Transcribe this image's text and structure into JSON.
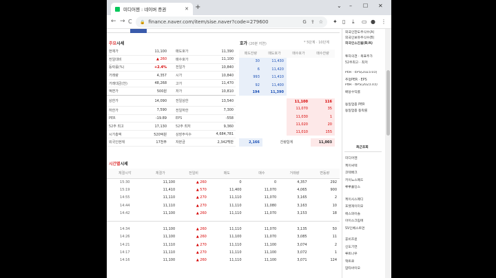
{
  "browser": {
    "tab_title": "미디어젠 : 네이버 증권",
    "url": "finance.naver.com/item/sise.naver?code=279600",
    "new_tab": "+",
    "back": "←",
    "forward": "→",
    "reload": "C",
    "controls": [
      "⌄",
      "–",
      "☐",
      "✕"
    ]
  },
  "quote": {
    "title_red": "주요",
    "title_rest": "시세",
    "rows": [
      [
        "현재가",
        "11,100",
        "매도호가",
        "11,390"
      ],
      [
        "전일대비",
        "▲ 260",
        "매수호가",
        "11,100"
      ],
      [
        "등락률(%)",
        "+2.4%",
        "전일가",
        "10,840"
      ],
      [
        "거래량",
        "4,357",
        "시가",
        "10,840"
      ],
      [
        "거래대금(천)",
        "48,268",
        "고가",
        "11,470"
      ],
      [
        "액면가",
        "500원",
        "저가",
        "10,810"
      ],
      [
        "상한가",
        "14,090",
        "전일상한",
        "13,540"
      ],
      [
        "하한가",
        "7,590",
        "전일하한",
        "7,300"
      ],
      [
        "PER",
        "-19.89",
        "EPS",
        "-558"
      ],
      [
        "52주 최고",
        "17,130",
        "52주 최저",
        "9,360"
      ],
      [
        "시가총액",
        "520억원",
        "상장주식수",
        "4,684,781"
      ],
      [
        "외국인현재",
        "17천주",
        "자본금",
        "2,342백만"
      ]
    ]
  },
  "hoga": {
    "title": "호가",
    "subtitle": "(20분 지연)",
    "note": "* 5단계 · 10단계",
    "headers": [
      "매도잔량",
      "매도호가",
      "매수호가",
      "매수잔량"
    ],
    "sell": [
      [
        "30",
        "11,430"
      ],
      [
        "6",
        "11,420"
      ],
      [
        "993",
        "11,410"
      ],
      [
        "92",
        "11,400"
      ],
      [
        "194",
        "11,390"
      ]
    ],
    "buy": [
      [
        "11,100",
        "116"
      ],
      [
        "11,070",
        "35"
      ],
      [
        "11,030",
        "1"
      ],
      [
        "11,020",
        "20"
      ],
      [
        "11,010",
        "155"
      ]
    ],
    "total_sell": "2,166",
    "total_label": "잔량합계",
    "total_buy": "11,003"
  },
  "trades": {
    "title_red": "시간별",
    "title_rest": "시세",
    "headers": [
      "체결시각",
      "체결가",
      "전일비",
      "매도",
      "매수",
      "거래량",
      "변동량"
    ],
    "rows1": [
      [
        "15:30",
        "11,100",
        "▲ 260",
        "0",
        "0",
        "4,357",
        "292"
      ],
      [
        "15:19",
        "11,410",
        "▲ 570",
        "11,400",
        "11,070",
        "4,065",
        "900"
      ],
      [
        "14:55",
        "11,110",
        "▲ 270",
        "11,110",
        "11,070",
        "3,165",
        "2"
      ],
      [
        "14:44",
        "11,110",
        "▲ 270",
        "11,110",
        "11,080",
        "3,163",
        "10"
      ],
      [
        "14:42",
        "11,100",
        "▲ 260",
        "11,110",
        "11,070",
        "3,153",
        "18"
      ]
    ],
    "rows2": [
      [
        "14:34",
        "11,100",
        "▲ 260",
        "11,110",
        "11,070",
        "3,135",
        "50"
      ],
      [
        "14:26",
        "11,100",
        "▲ 260",
        "11,100",
        "11,070",
        "3,085",
        "11"
      ],
      [
        "14:21",
        "11,110",
        "▲ 270",
        "11,110",
        "11,100",
        "3,074",
        "2"
      ],
      [
        "14:17",
        "11,110",
        "▲ 270",
        "11,110",
        "11,100",
        "3,072",
        "1"
      ],
      [
        "14:16",
        "11,100",
        "▲ 260",
        "11,110",
        "11,100",
        "3,071",
        "124"
      ]
    ]
  },
  "right": {
    "top": [
      "외국인한도주식수(A)",
      "외국인보유주식수(B)",
      "외국인소진율(B/A)"
    ],
    "mid": [
      "투자의견 · 목표주가",
      "52주최고 · 최저"
    ],
    "per": [
      "PER · EPS(2023.03)",
      "추정PER · EPS",
      "PBR · BPS(2023.03)",
      "배당수익률"
    ],
    "industry": [
      "동일업종 PER",
      "동일업종 등락률"
    ],
    "recent_title": "최근조회",
    "recent": [
      "미디어젠",
      "케이씨텍",
      "코텍배크",
      "키이노스메드",
      "루루홀딩스",
      "케이시스메디",
      "포켓게이미오",
      "에스와이솔",
      "아이스크림에",
      "SV인베스트먼",
      "휴비츠윈",
      "신도기연",
      "루트나우",
      "액트로",
      "압타바이오"
    ]
  }
}
